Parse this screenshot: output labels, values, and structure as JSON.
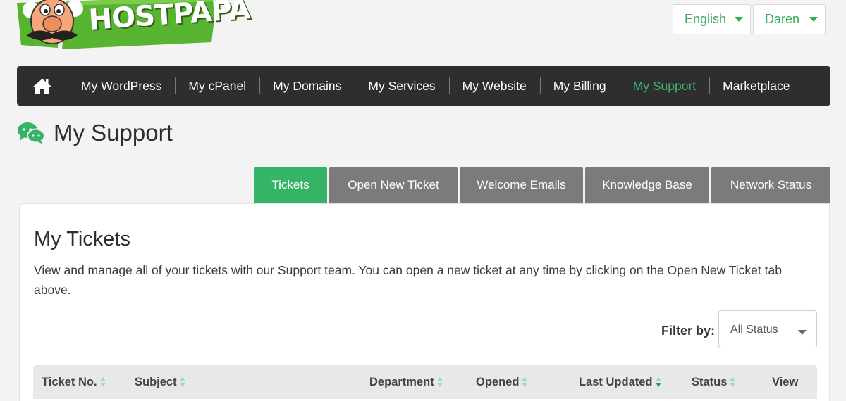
{
  "brand": {
    "logo_text": "HOSTPAPA",
    "colors": {
      "accent": "#35b467",
      "nav_bg": "#2e2e2e",
      "tab_inactive": "#7b7b7b"
    }
  },
  "header": {
    "language_select": {
      "value": "English",
      "icon": "chevron-down-icon"
    },
    "user_select": {
      "value": "Daren",
      "icon": "chevron-down-icon"
    }
  },
  "nav": {
    "home_icon": "home-icon",
    "items": [
      {
        "label": "My WordPress",
        "active": false
      },
      {
        "label": "My cPanel",
        "active": false
      },
      {
        "label": "My Domains",
        "active": false
      },
      {
        "label": "My Services",
        "active": false
      },
      {
        "label": "My Website",
        "active": false
      },
      {
        "label": "My Billing",
        "active": false
      },
      {
        "label": "My Support",
        "active": true
      },
      {
        "label": "Marketplace",
        "active": false
      }
    ]
  },
  "page": {
    "title": "My Support",
    "title_icon": "chat-bubbles-icon"
  },
  "tabs": [
    {
      "label": "Tickets",
      "active": true
    },
    {
      "label": "Open New Ticket",
      "active": false
    },
    {
      "label": "Welcome Emails",
      "active": false
    },
    {
      "label": "Knowledge Base",
      "active": false
    },
    {
      "label": "Network Status",
      "active": false
    }
  ],
  "tickets": {
    "title": "My Tickets",
    "description": "View and manage all of your tickets with our Support team. You can open a new ticket at any time by clicking on the Open New Ticket tab above.",
    "filter": {
      "label": "Filter by:",
      "value": "All Status"
    },
    "columns": [
      {
        "label": "Ticket No.",
        "sortable": true,
        "sort": "none"
      },
      {
        "label": "Subject",
        "sortable": true,
        "sort": "none"
      },
      {
        "label": "Department",
        "sortable": true,
        "sort": "none"
      },
      {
        "label": "Opened",
        "sortable": true,
        "sort": "none"
      },
      {
        "label": "Last Updated",
        "sortable": true,
        "sort": "desc"
      },
      {
        "label": "Status",
        "sortable": true,
        "sort": "none"
      },
      {
        "label": "View",
        "sortable": false,
        "sort": "none"
      }
    ]
  }
}
